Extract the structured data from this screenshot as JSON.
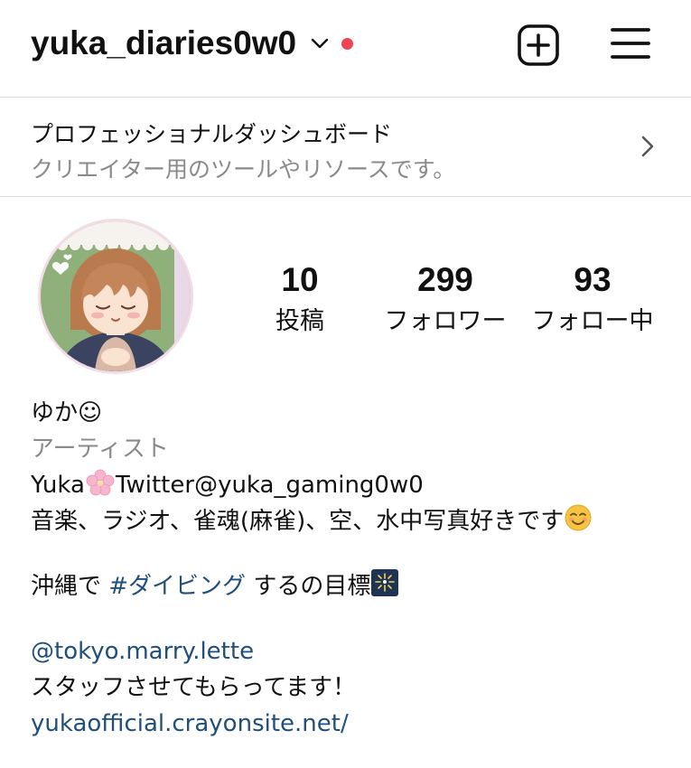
{
  "header": {
    "username": "yuka_diaries0w0"
  },
  "dashboard": {
    "title": "プロフェッショナルダッシュボード",
    "subtitle": "クリエイター用のツールやリソースです。"
  },
  "stats": {
    "posts": {
      "count": "10",
      "label": "投稿"
    },
    "followers": {
      "count": "299",
      "label": "フォロワー"
    },
    "following": {
      "count": "93",
      "label": "フォロー中"
    }
  },
  "bio": {
    "name": "ゆか☺",
    "category": "アーティスト",
    "line1_a": "Yuka",
    "line1_b": "Twitter@yuka_gaming0w0",
    "line2": "音楽、ラジオ、雀魂(麻雀)、空、水中写真好きです",
    "line3_a": "沖縄で ",
    "line3_hashtag": "#ダイビング",
    "line3_b": " するの目標",
    "mention": " @tokyo.marry.lette",
    "line5": "スタッフさせてもらってます！",
    "website": "yukaofficial.crayonsite.net/"
  },
  "colors": {
    "notify_dot": "#ef4550",
    "link": "#1f4f7a",
    "secondary_text": "#8a8a8a"
  },
  "icons": {
    "username_dropdown": "chevron-down-icon",
    "notification": "notification-dot",
    "create": "plus-square-icon",
    "menu": "hamburger-menu-icon",
    "dashboard_arrow": "chevron-right-icon",
    "avatar": "avatar-illustration",
    "sakura": "cherry-blossom-emoji",
    "smile": "smiling-face-emoji",
    "fireworks": "fireworks-emoji"
  }
}
